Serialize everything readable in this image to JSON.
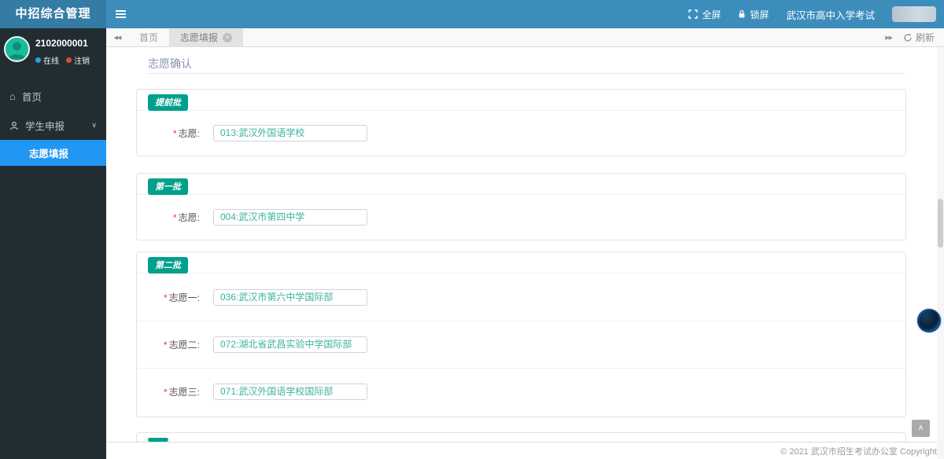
{
  "app": {
    "logo_title": "中招综合管理"
  },
  "navbar": {
    "fullscreen_label": "全屏",
    "lockscreen_label": "锁屏",
    "exam_title": "武汉市高中入学考试"
  },
  "sidebar": {
    "user_id": "2102000001",
    "status_online": "在线",
    "status_logout": "注销",
    "nav_home": "首页",
    "menu_student": "学生申报",
    "submenu_volunteer": "志愿填报"
  },
  "tabs": {
    "home": "首页",
    "active": "志愿填报",
    "refresh_label": "刷新"
  },
  "icons": {
    "home": "⌂",
    "chevron_down": "∨",
    "tab_back": "◀◀",
    "tab_forward": "▶▶",
    "tab_close": "×",
    "back_to_top": "∧"
  },
  "main": {
    "page_title": "志愿确认",
    "required_mark": "*",
    "sections": [
      {
        "badge": "提前批",
        "rows": [
          {
            "label": "志愿:",
            "value": "013:武汉外国语学校"
          }
        ]
      },
      {
        "badge": "第一批",
        "rows": [
          {
            "label": "志愿:",
            "value": "004:武汉市第四中学"
          }
        ]
      },
      {
        "badge": "第二批",
        "rows": [
          {
            "label": "志愿一:",
            "value": "036:武汉市第六中学国际部"
          },
          {
            "label": "志愿二:",
            "value": "072:湖北省武昌实验中学国际部"
          },
          {
            "label": "志愿三:",
            "value": "071:武汉外国语学校国际部"
          }
        ]
      },
      {
        "badge": "",
        "rows": []
      }
    ]
  },
  "footer": {
    "copyright": "© 2021 武汉市招生考试办公室 Copyright"
  },
  "colors": {
    "navbar_bg": "#3c8dbc",
    "logo_bg": "#357ca5",
    "sidebar_bg": "#222d32",
    "active_menu": "#2196f3",
    "badge_green": "#00a08c",
    "value_teal": "#3cb29c",
    "online_dot": "#2d9fe0",
    "logout_dot": "#dd4b39"
  }
}
